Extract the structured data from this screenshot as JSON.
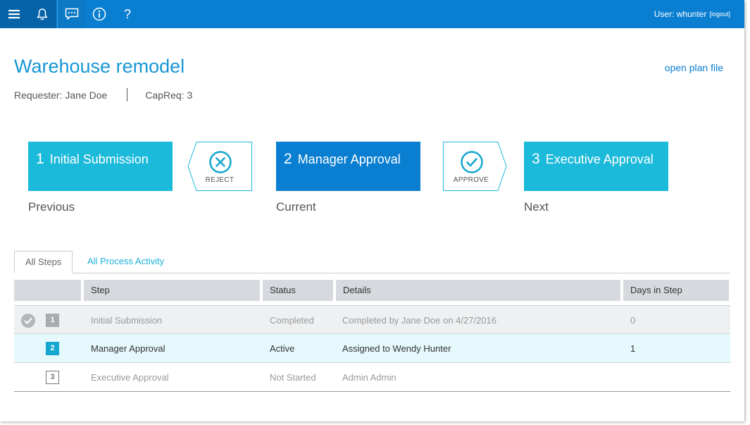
{
  "topbar": {
    "help_glyph": "?",
    "user_label": "User: whunter",
    "logout_label": "[logout]",
    "icons": [
      "menu-icon",
      "bell-icon",
      "chat-icon",
      "info-icon",
      "help-icon"
    ]
  },
  "header": {
    "title": "Warehouse remodel",
    "open_plan_link": "open plan file",
    "requester": "Requester: Jane Doe",
    "capreq": "CapReq: 3"
  },
  "workflow": {
    "previous": {
      "number": "1",
      "name": "Initial Submission",
      "caption": "Previous"
    },
    "current": {
      "number": "2",
      "name": "Manager Approval",
      "caption": "Current"
    },
    "next": {
      "number": "3",
      "name": "Executive Approval",
      "caption": "Next"
    },
    "reject_label": "REJECT",
    "approve_label": "APPROVE"
  },
  "tabs": [
    {
      "label": "All Steps",
      "active": true
    },
    {
      "label": "All Process Activity",
      "active": false
    }
  ],
  "table": {
    "columns": [
      "Step",
      "Status",
      "Details",
      "Days in Step"
    ],
    "rows": [
      {
        "num": "1",
        "step": "Initial Submission",
        "status": "Completed",
        "details": "Completed by Jane Doe on 4/27/2016",
        "days": "0"
      },
      {
        "num": "2",
        "step": "Manager Approval",
        "status": "Active",
        "details": "Assigned to Wendy Hunter",
        "days": "1"
      },
      {
        "num": "3",
        "step": "Executive Approval",
        "status": "Not Started",
        "details": "Admin Admin",
        "days": ""
      }
    ]
  },
  "colors": {
    "topbar": "#0a7fd1",
    "topbar_dark": "#0663a8",
    "title": "#1797d4",
    "step_inactive": "#1bbada",
    "step_current": "#0a7fd1",
    "action_icon": "#14a7cf",
    "active_row": "#e5f8fc"
  }
}
